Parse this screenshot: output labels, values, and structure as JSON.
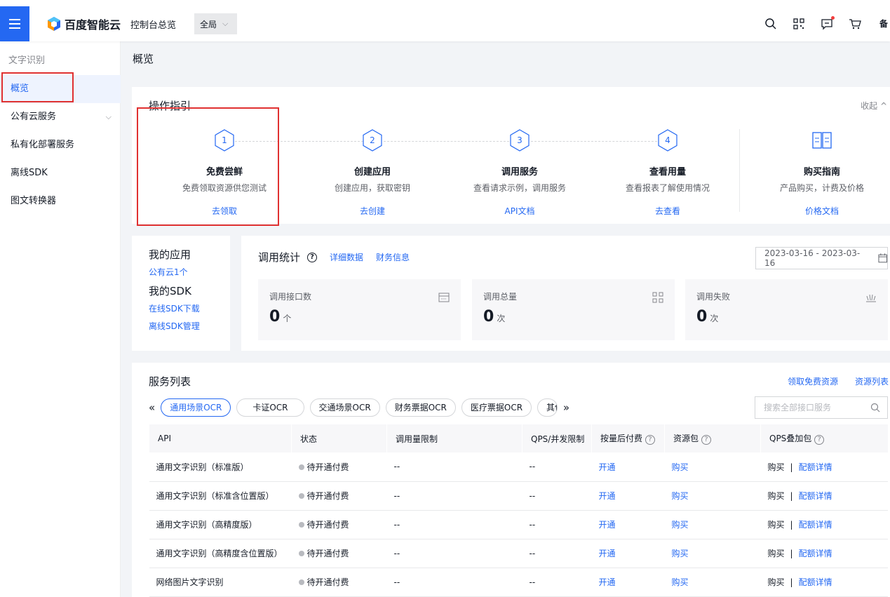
{
  "topbar": {
    "logo_text": "百度智能云",
    "console_link": "控制台总览",
    "region": "全局",
    "extra": "备"
  },
  "sidebar": {
    "title": "文字识别",
    "items": [
      {
        "label": "概览"
      },
      {
        "label": "公有云服务"
      },
      {
        "label": "私有化部署服务"
      },
      {
        "label": "离线SDK"
      },
      {
        "label": "图文转换器"
      }
    ]
  },
  "main": {
    "page_title": "概览"
  },
  "guide": {
    "title": "操作指引",
    "collapse": "收起",
    "steps": [
      {
        "num": "1",
        "title": "免费尝鲜",
        "desc": "免费领取资源供您测试",
        "link": "去领取"
      },
      {
        "num": "2",
        "title": "创建应用",
        "desc": "创建应用，获取密钥",
        "link": "去创建"
      },
      {
        "num": "3",
        "title": "调用服务",
        "desc": "查看请求示例，调用服务",
        "link": "API文档"
      },
      {
        "num": "4",
        "title": "查看用量",
        "desc": "查看报表了解使用情况",
        "link": "去查看"
      },
      {
        "num": "",
        "title": "购买指南",
        "desc": "产品购买，计费及价格",
        "link": "价格文档"
      }
    ]
  },
  "myapp": {
    "app_title": "我的应用",
    "app_link": "公有云1个",
    "sdk_title": "我的SDK",
    "sdk_online": "在线SDK下载",
    "sdk_offline": "离线SDK管理"
  },
  "stats": {
    "title": "调用统计",
    "detail_link": "详细数据",
    "finance_link": "财务信息",
    "date_range": "2023-03-16 - 2023-03-16",
    "cards": [
      {
        "label": "调用接口数",
        "value": "0",
        "unit": "个"
      },
      {
        "label": "调用总量",
        "value": "0",
        "unit": "次"
      },
      {
        "label": "调用失败",
        "value": "0",
        "unit": "次"
      }
    ]
  },
  "services": {
    "title": "服务列表",
    "free_link": "领取免费资源",
    "list_link": "资源列表",
    "tabs": [
      "通用场景OCR",
      "卡证OCR",
      "交通场景OCR",
      "财务票据OCR",
      "医疗票据OCR",
      "其他"
    ],
    "search_placeholder": "搜索全部接口服务",
    "columns": [
      "API",
      "状态",
      "调用量限制",
      "QPS/并发限制",
      "按量后付费",
      "资源包",
      "QPS叠加包"
    ],
    "rows": [
      {
        "api": "通用文字识别（标准版）",
        "status": "待开通付费",
        "limit": "--",
        "qps": "--",
        "postpaid": "开通",
        "pack": "购买",
        "qps_buy": "购买",
        "qps_detail": "配额详情"
      },
      {
        "api": "通用文字识别（标准含位置版）",
        "status": "待开通付费",
        "limit": "--",
        "qps": "--",
        "postpaid": "开通",
        "pack": "购买",
        "qps_buy": "购买",
        "qps_detail": "配额详情"
      },
      {
        "api": "通用文字识别（高精度版）",
        "status": "待开通付费",
        "limit": "--",
        "qps": "--",
        "postpaid": "开通",
        "pack": "购买",
        "qps_buy": "购买",
        "qps_detail": "配额详情"
      },
      {
        "api": "通用文字识别（高精度含位置版）",
        "status": "待开通付费",
        "limit": "--",
        "qps": "--",
        "postpaid": "开通",
        "pack": "购买",
        "qps_buy": "购买",
        "qps_detail": "配额详情"
      },
      {
        "api": "网络图片文字识别",
        "status": "待开通付费",
        "limit": "--",
        "qps": "--",
        "postpaid": "开通",
        "pack": "购买",
        "qps_buy": "购买",
        "qps_detail": "配额详情"
      }
    ]
  }
}
